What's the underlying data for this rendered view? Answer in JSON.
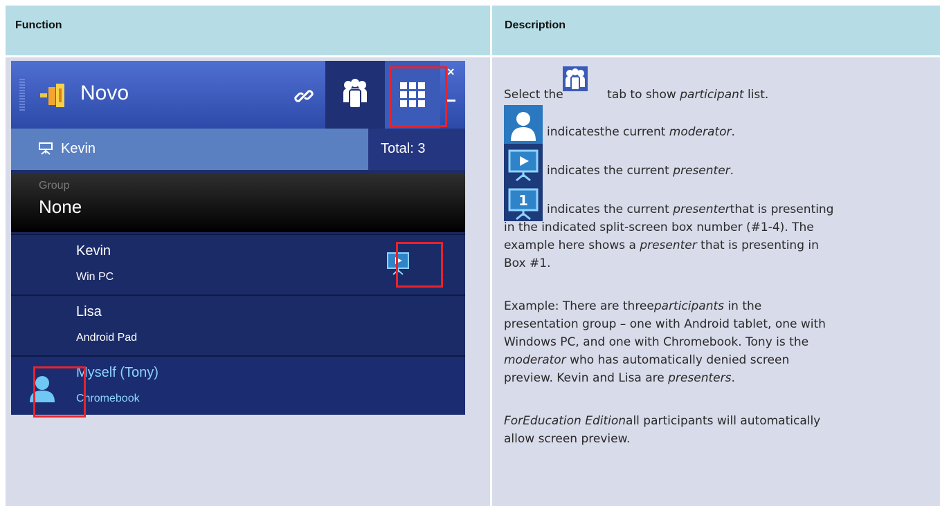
{
  "table": {
    "header_left": "Function",
    "header_right": "Description"
  },
  "novo_panel": {
    "app_name": "Novo",
    "close_label": "×",
    "current_presenter": "Kevin",
    "total": "Total: 3",
    "group_label": "Group",
    "group_value": "None",
    "participants": [
      {
        "name": "Kevin",
        "device": "Win PC",
        "role": "presenter"
      },
      {
        "name": "Lisa",
        "device": "Android Pad",
        "role": ""
      },
      {
        "name": "Myself (Tony)",
        "device": "Chromebook",
        "role": "moderator"
      }
    ],
    "colors": {
      "highlight": "#e8232a",
      "panel_bg": "#1c2d6a",
      "accent": "#4f6fd2"
    }
  },
  "description": {
    "line1_pre": "Select the",
    "line1_post": " tab to show ",
    "line1_em": "participant",
    "line1_end": " list.",
    "line2_pre": "indicatesthe current ",
    "line2_em": "moderator",
    "line2_end": ".",
    "line3_pre": "indicates the current ",
    "line3_em": "presenter",
    "line3_end": ".",
    "line4_pre": " indicates the current ",
    "line4_em": "presenter",
    "line4_end": "that is presenting",
    "line5": "in the indicated split-screen box number (#1-4). The",
    "line6_pre": "example here shows a ",
    "line6_em": "presenter",
    "line6_end": " that is presenting in",
    "line7": "Box #1.",
    "line8_pre": "Example: There are three",
    "line8_em": "participants",
    "line8_end": " in the",
    "line9": "presentation group – one with Android tablet, one with",
    "line10": "Windows PC, and one with Chromebook. Tony is the",
    "line11_em": "moderator",
    "line11_end": " who has automatically denied screen",
    "line12_pre": "preview. Kevin and Lisa are ",
    "line12_em": "presenters",
    "line12_end": ".",
    "line13_em": "ForEducation Edition",
    "line13_end": "all participants will automatically",
    "line14": "allow screen preview.",
    "box_number": "1"
  }
}
